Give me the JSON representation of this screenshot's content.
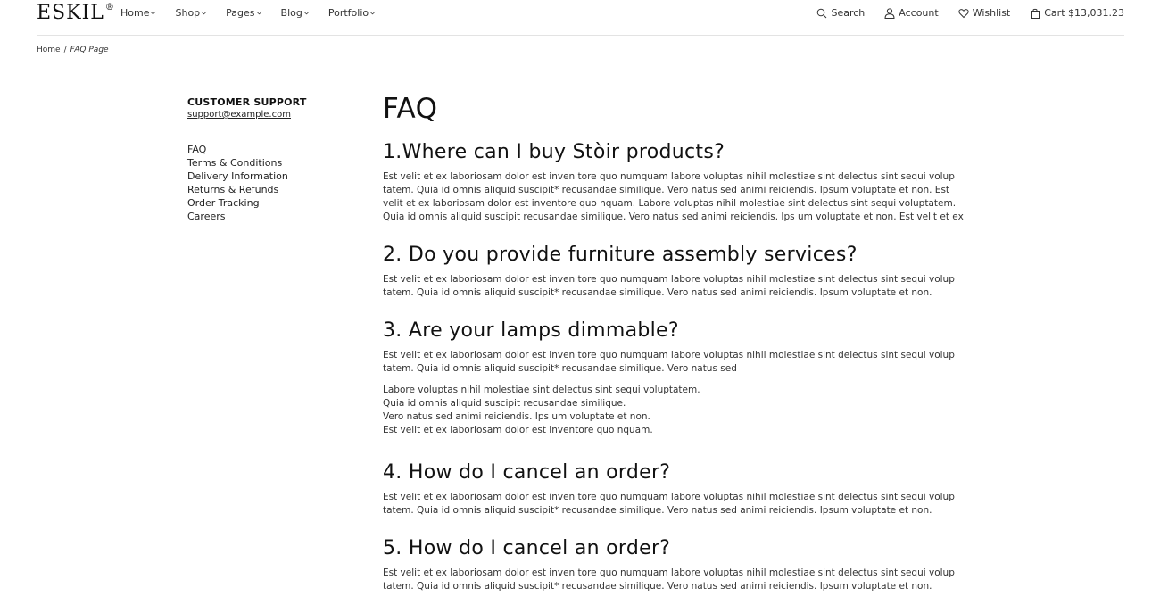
{
  "header": {
    "logo": "ESKIL",
    "logo_mark": "®",
    "nav": [
      "Home",
      "Shop",
      "Pages",
      "Blog",
      "Portfolio"
    ],
    "search_label": "Search",
    "account_label": "Account",
    "wishlist_label": "Wishlist",
    "cart_label": "Cart $13,031.23"
  },
  "breadcrumb": {
    "home": "Home",
    "separator": "/",
    "current": "FAQ Page"
  },
  "sidebar": {
    "title": "CUSTOMER SUPPORT",
    "email": "support@example.com",
    "links": [
      "FAQ",
      "Terms & Conditions",
      "Delivery Information",
      "Returns & Refunds",
      "Order Tracking",
      "Careers"
    ]
  },
  "main": {
    "title": "FAQ",
    "questions": [
      {
        "title": "1.Where can I buy Stòir products?",
        "body": "Est velit et ex laboriosam dolor est inven tore quo numquam labore voluptas nihil molestiae sint delectus sint sequi volup tatem. Quia id omnis aliquid suscipit* recusandae similique. Vero natus sed animi reiciendis. Ipsum voluptate et non. Est velit et ex laboriosam dolor est inventore quo nquam. Labore voluptas nihil molestiae sint delectus sint sequi voluptatem. Quia id omnis aliquid suscipit recusandae similique. Vero natus sed animi reiciendis. Ips um voluptate et non. Est velit et ex"
      },
      {
        "title": "2. Do you provide furniture assembly services?",
        "body": "Est velit et ex laboriosam dolor est inven tore quo numquam labore voluptas nihil molestiae sint delectus sint sequi volup tatem. Quia id omnis aliquid suscipit* recusandae similique. Vero natus sed animi reiciendis. Ipsum voluptate et non."
      },
      {
        "title": "3. Are your lamps dimmable?",
        "body": "Est velit et ex laboriosam dolor est inven tore quo numquam labore voluptas nihil molestiae sint delectus sint sequi volup tatem. Quia id omnis aliquid suscipit* recusandae similique. Vero natus sed",
        "lines": [
          " Labore voluptas nihil molestiae sint delectus sint sequi voluptatem.",
          "Quia id omnis aliquid suscipit recusandae similique.",
          "Vero natus sed animi reiciendis. Ips um voluptate et non.",
          "Est velit et ex laboriosam dolor est inventore quo nquam."
        ]
      },
      {
        "title": "4. How do I cancel an order?",
        "body": "Est velit et ex laboriosam dolor est inven tore quo numquam labore voluptas nihil molestiae sint delectus sint sequi volup tatem. Quia id omnis aliquid suscipit* recusandae similique. Vero natus sed animi reiciendis. Ipsum voluptate et non."
      },
      {
        "title": "5. How do I cancel an order?",
        "body": "Est velit et ex laboriosam dolor est inven tore quo numquam labore voluptas nihil molestiae sint delectus sint sequi volup tatem. Quia id omnis aliquid suscipit* recusandae similique. Vero natus sed animi reiciendis. Ipsum voluptate et non."
      }
    ]
  }
}
